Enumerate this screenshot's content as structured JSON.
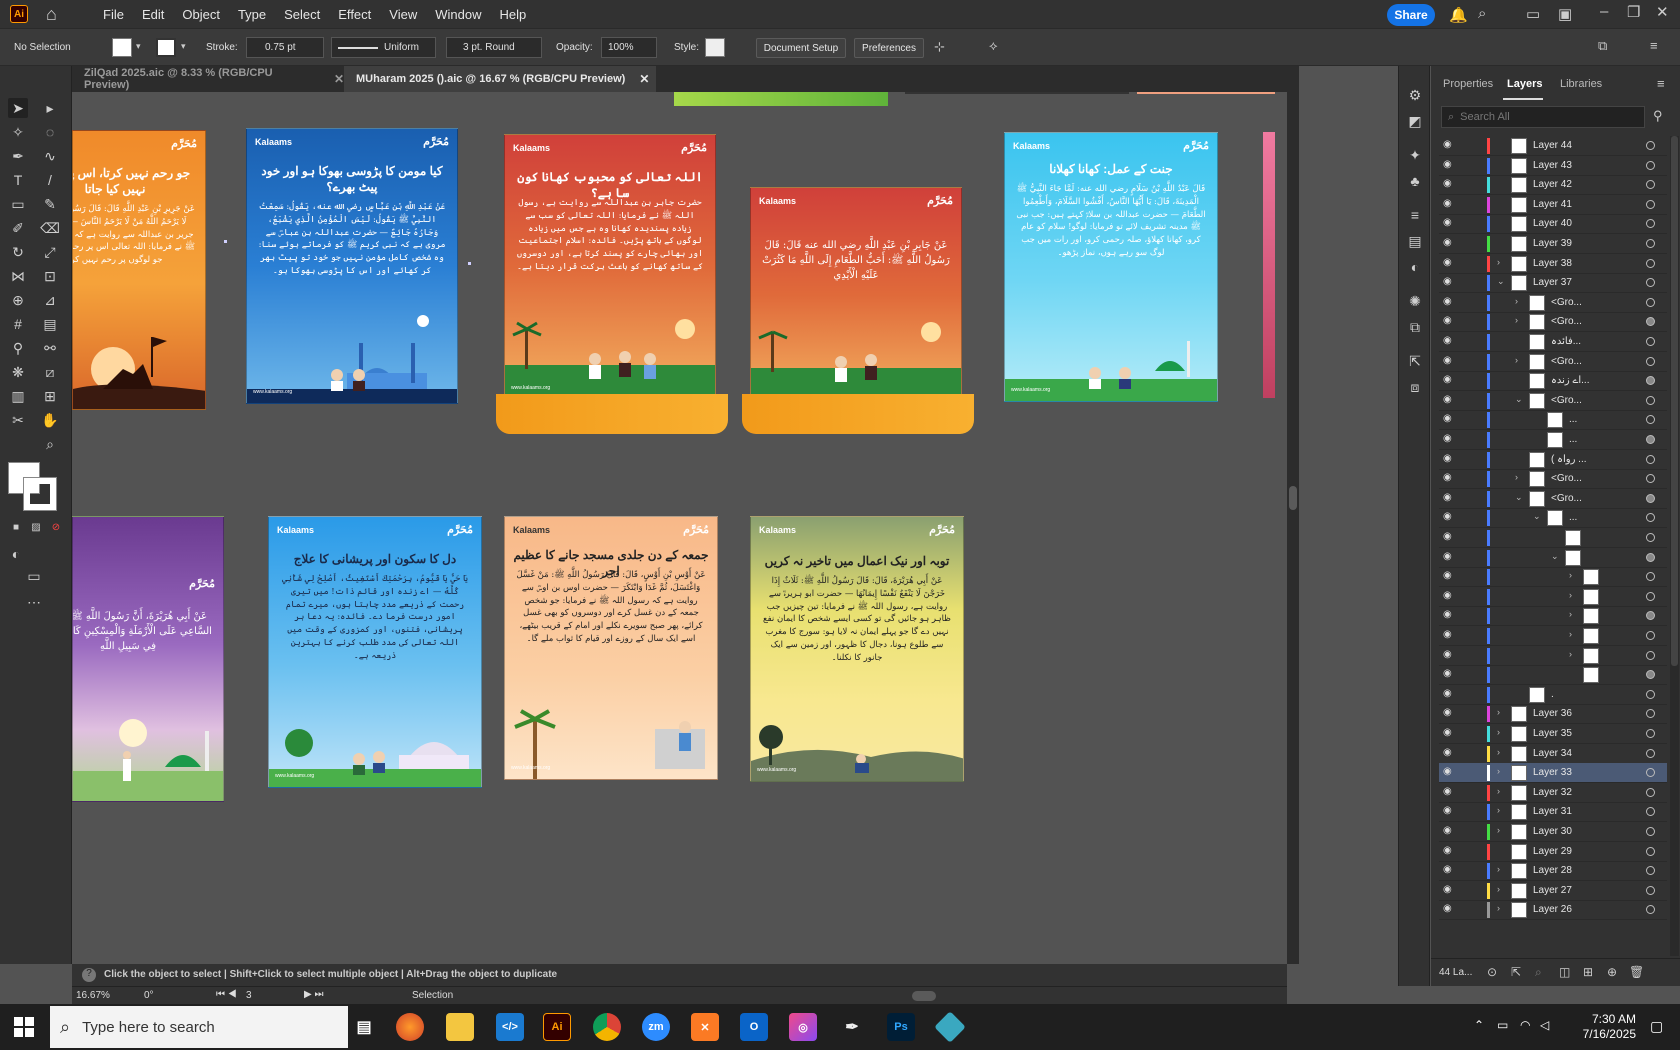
{
  "menubar": {
    "app_icon": "Ai",
    "items": [
      "File",
      "Edit",
      "Object",
      "Type",
      "Select",
      "Effect",
      "View",
      "Window",
      "Help"
    ],
    "share": "Share"
  },
  "controlbar": {
    "selection": "No Selection",
    "stroke_label": "Stroke:",
    "stroke_value": "0.75 pt",
    "stroke_style": "Uniform",
    "brush": "3 pt. Round",
    "opacity_label": "Opacity:",
    "opacity_value": "100%",
    "style_label": "Style:",
    "document_setup": "Document Setup",
    "preferences": "Preferences"
  },
  "tabs": [
    {
      "label": "ZilQad 2025.aic @ 8.33 % (RGB/CPU Preview)",
      "active": false
    },
    {
      "label": "MUharam 2025 ().aic @ 16.67 % (RGB/CPU Preview)",
      "active": true
    }
  ],
  "artboards": {
    "brand": "Kalaams",
    "badge": "مُحَرَّم",
    "footer": "www.kalaams.org",
    "ab1": {
      "title": "جو رحم نہیں کرتا، اس پر رحم نہیں کیا جاتا",
      "body": "عَنْ جَرِيرِ بْنِ عَبْدِ اللَّهِ قَالَ: قَالَ رَسُولُ اللَّهِ ﷺ: لَا يَرْحَمُ اللَّهُ مَنْ لَا يَرْحَمُ النَّاسَ — حضرت جریر بن عبداللہ سے روایت ہے کہ رسول اللہ ﷺ نے فرمایا: اللہ تعالی اس پر رحم نہیں کرتا جو لوگوں پر رحم نہیں کرتا"
    },
    "ab2": {
      "title": "کیا مومن کا پڑوسی بھوکا ہو اور خود پیٹ بھرے؟",
      "body": "عَنْ عَبْدِ اللَّهِ بْنِ عَبَّاسٍ رضي الله عنه، يَقُولُ: سَمِعْتُ النَّبِيَّ ﷺ يَقُولُ: لَيْسَ الْمُؤْمِنُ الَّذِي يَشْبَعُ، وَجَارُهُ جَائِعٌ — حضرت عبداللہ بن عباسؓ سے مروی ہے کہ نبی کریم ﷺ کو فرماتے ہوئے سنا: وہ شخص کامل مؤمن نہیں جو خود تو پیٹ بھر کر کھائے اور اس کا پڑوسی بھوکا ہو۔"
    },
    "ab3": {
      "title": "اللہ تعالی کو محبوب کھانا کون سا ہے؟",
      "body": "حضرت جابر بن عبداللہ سے روایت ہے، رسول اللہ ﷺ نے فرمایا: اللہ تعالی کو سب سے زیادہ پسندیدہ کھانا وہ ہے جس میں زیادہ لوگوں کے ہاتھ پڑیں۔ فائدہ: اسلام اجتماعیت اور بھائی چارے کو پسند کرتا ہے، اور دوسروں کے ساتھ کھانے کو باعث برکت قرار دیتا ہے۔"
    },
    "ab4": {
      "title": "",
      "body": "عَنْ جَابِرِ بْنِ عَبْدِ اللَّهِ رضي الله عنه قَالَ: قَالَ رَسُولُ اللَّهِ ﷺ: أَحَبُّ الطَّعَامِ إِلَى اللَّهِ مَا كَثُرَتْ عَلَيْهِ الْأَيْدِي"
    },
    "ab5": {
      "title": "جنت کے عمل: کھانا کھلانا",
      "body": "قَالَ عَبْدُ اللَّهِ بْنُ سَلَامٍ رضي الله عنه: لَمَّا جَاءَ النَّبِيُّ ﷺ الْمَدِينَةَ، قَالَ: يَا أَيُّهَا النَّاسُ، أَفْشُوا السَّلَامَ، وَأَطْعِمُوا الطَّعَامَ — حضرت عبداللہ بن سلامؓ کہتے ہیں: جب نبی ﷺ مدینہ تشریف لائے تو فرمایا: لوگو! سلام کو عام کرو، کھانا کھلاؤ، صلہ رحمی کرو، اور رات میں جب لوگ سو رہے ہوں، نماز پڑھو۔"
    },
    "ab6": {
      "title": "",
      "body": "عَنْ أَبِي هُرَيْرَةَ، أَنَّ رَسُولَ اللَّهِ ﷺ قَالَ: السَّاعِي عَلَى الْأَرْمَلَةِ وَالْمِسْكِينِ كَالْمُجَاهِدِ فِي سَبِيلِ اللَّهِ"
    },
    "ab7": {
      "title": "دل کا سکون اور پریشانی کا علاج",
      "body": "يَا حَيُّ يَا قَيُّومُ، بِرَحْمَتِكَ أَسْتَغِيثُ، أَصْلِحْ لِي شَأْنِي كُلَّهُ — اے زندہ اور قائم ذات! میں تیری رحمت کے ذریعے مدد چاہتا ہوں، میرے تمام امور درست فرما دے۔ فائدہ: یہ دعا ہر پریشانی، فتنوں، اور کمزوری کے وقت میں اللہ تعالی کی مدد طلب کرنے کا بہترین ذریعہ ہے۔"
    },
    "ab8": {
      "title": "جمعہ کے دن جلدی مسجد جانے کا عظیم اجر",
      "body": "عَنْ أَوْسِ بْنِ أَوْسٍ، قَالَ: قَالَ رَسُولُ اللَّهِ ﷺ: مَنْ غَسَّلَ وَاغْتَسَلَ، ثُمَّ غَدَا وَابْتَكَرَ — حضرت اوس بن اوسؓ سے روایت ہے کہ رسول اللہ ﷺ نے فرمایا: جو شخص جمعہ کے دن غسل کرے اور دوسروں کو بھی غسل کرائے، پھر صبح سویرے نکلے اور امام کے قریب بیٹھے، اسے ایک سال کے روزے اور قیام کا ثواب ملے گا۔"
    },
    "ab9": {
      "title": "توبہ اور نیک اعمال میں تاخیر نہ کریں",
      "body": "عَنْ أَبِي هُرَيْرَةَ، قَالَ: قَالَ رَسُولُ اللَّهِ ﷺ: ثَلَاثٌ إِذَا خَرَجْنَ لَا يَنْفَعُ نَفْسًا إِيمَانُهَا — حضرت ابو ہریرہؓ سے روایت ہے، رسول اللہ ﷺ نے فرمایا: تین چیزیں جب ظاہر ہو جائیں گی تو کسی ایسے شخص کا ایمان نفع نہیں دے گا جو پہلے ایمان نہ لایا ہو: سورج کا مغرب سے طلوع ہونا، دجال کا ظہور، اور زمین سے ایک جانور کا نکلنا۔"
    }
  },
  "status": {
    "hint": "Click the object to select  |  Shift+Click to select multiple object  |  Alt+Drag the object to duplicate",
    "zoom": "16.67%",
    "rotation": "0°",
    "artboard_num": "3",
    "tool": "Selection"
  },
  "layers_panel": {
    "tabs": [
      "Properties",
      "Layers",
      "Libraries"
    ],
    "search_placeholder": "Search All",
    "footer_count": "44 La...",
    "rows": [
      {
        "name": "Layer 44",
        "color": "#ff4444",
        "indent": 0,
        "expand": ""
      },
      {
        "name": "Layer 43",
        "color": "#4a7cff",
        "indent": 0,
        "expand": ""
      },
      {
        "name": "Layer 42",
        "color": "#44dddd",
        "indent": 0,
        "expand": ""
      },
      {
        "name": "Layer 41",
        "color": "#dd44dd",
        "indent": 0,
        "expand": ""
      },
      {
        "name": "Layer 40",
        "color": "#4a7cff",
        "indent": 0,
        "expand": ""
      },
      {
        "name": "Layer 39",
        "color": "#44dd44",
        "indent": 0,
        "expand": ""
      },
      {
        "name": "Layer 38",
        "color": "#ff4444",
        "indent": 0,
        "expand": "›"
      },
      {
        "name": "Layer 37",
        "color": "#4a7cff",
        "indent": 0,
        "expand": "⌄"
      },
      {
        "name": "<Gro...",
        "color": "#4a7cff",
        "indent": 1,
        "expand": "›"
      },
      {
        "name": "<Gro...",
        "color": "#4a7cff",
        "indent": 1,
        "expand": "›"
      },
      {
        "name": "فائدہ...",
        "color": "#4a7cff",
        "indent": 1,
        "expand": ""
      },
      {
        "name": "<Gro...",
        "color": "#4a7cff",
        "indent": 1,
        "expand": "›"
      },
      {
        "name": "اے زندہ...",
        "color": "#4a7cff",
        "indent": 1,
        "expand": ""
      },
      {
        "name": "<Gro...",
        "color": "#4a7cff",
        "indent": 1,
        "expand": "⌄"
      },
      {
        "name": "...",
        "color": "#4a7cff",
        "indent": 2,
        "expand": ""
      },
      {
        "name": "...",
        "color": "#4a7cff",
        "indent": 2,
        "expand": ""
      },
      {
        "name": "( رواہ ...",
        "color": "#4a7cff",
        "indent": 1,
        "expand": ""
      },
      {
        "name": "<Gro...",
        "color": "#4a7cff",
        "indent": 1,
        "expand": "›"
      },
      {
        "name": "<Gro...",
        "color": "#4a7cff",
        "indent": 1,
        "expand": "⌄"
      },
      {
        "name": "...",
        "color": "#4a7cff",
        "indent": 2,
        "expand": "⌄"
      },
      {
        "name": "",
        "color": "#4a7cff",
        "indent": 3,
        "expand": ""
      },
      {
        "name": "",
        "color": "#4a7cff",
        "indent": 3,
        "expand": "⌄"
      },
      {
        "name": "",
        "color": "#4a7cff",
        "indent": 4,
        "expand": "›"
      },
      {
        "name": "",
        "color": "#4a7cff",
        "indent": 4,
        "expand": "›"
      },
      {
        "name": "",
        "color": "#4a7cff",
        "indent": 4,
        "expand": "›"
      },
      {
        "name": "",
        "color": "#4a7cff",
        "indent": 4,
        "expand": "›"
      },
      {
        "name": "",
        "color": "#4a7cff",
        "indent": 4,
        "expand": "›"
      },
      {
        "name": "",
        "color": "#4a7cff",
        "indent": 4,
        "expand": ""
      },
      {
        "name": ".",
        "color": "#4a7cff",
        "indent": 1,
        "expand": ""
      },
      {
        "name": "Layer 36",
        "color": "#dd44dd",
        "indent": 0,
        "expand": "›"
      },
      {
        "name": "Layer 35",
        "color": "#44dddd",
        "indent": 0,
        "expand": "›"
      },
      {
        "name": "Layer 34",
        "color": "#ffdd44",
        "indent": 0,
        "expand": "›"
      },
      {
        "name": "Layer 33",
        "color": "#ffffff",
        "indent": 0,
        "expand": "›",
        "selected": true
      },
      {
        "name": "Layer 32",
        "color": "#ff4444",
        "indent": 0,
        "expand": "›"
      },
      {
        "name": "Layer 31",
        "color": "#4a7cff",
        "indent": 0,
        "expand": "›"
      },
      {
        "name": "Layer 30",
        "color": "#44dd44",
        "indent": 0,
        "expand": "›"
      },
      {
        "name": "Layer 29",
        "color": "#ff4444",
        "indent": 0,
        "expand": ""
      },
      {
        "name": "Layer 28",
        "color": "#4a7cff",
        "indent": 0,
        "expand": "›"
      },
      {
        "name": "Layer 27",
        "color": "#ffdd44",
        "indent": 0,
        "expand": "›"
      },
      {
        "name": "Layer 26",
        "color": "#999999",
        "indent": 0,
        "expand": "›"
      }
    ]
  },
  "taskbar": {
    "search_placeholder": "Type here to search",
    "time": "7:30 AM",
    "date": "7/16/2025",
    "apps": [
      "Task View",
      "Firefox",
      "File Explorer",
      "VS Code",
      "Illustrator",
      "Chrome",
      "Zoom",
      "XAMPP",
      "Outlook",
      "Color Picker",
      "Inkscape",
      "Photoshop",
      "Git"
    ]
  }
}
